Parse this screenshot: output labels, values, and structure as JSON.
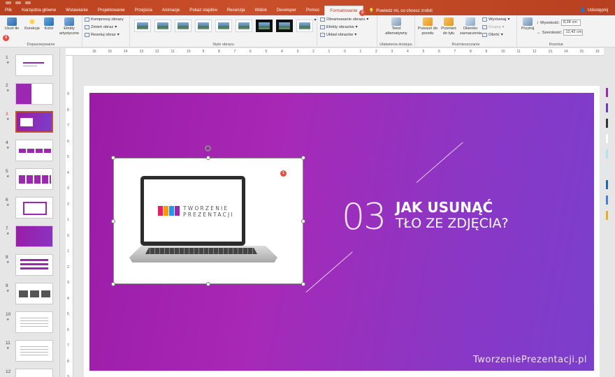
{
  "tabs": [
    "Plik",
    "Narzędzia główne",
    "Wstawianie",
    "Projektowanie",
    "Przejścia",
    "Animacje",
    "Pokaz slajdów",
    "Recenzja",
    "Widok",
    "Developer",
    "Pomoc",
    "Formatowanie"
  ],
  "tell_me": "Powiedz mi, co chcesz zrobić",
  "share": "Udostępnij",
  "ribbon": {
    "remove_bg": "Usuń tło",
    "corrections": "Korekcje",
    "color": "Kolor",
    "artistic_effects": "Efekty artystyczne",
    "compress": "Kompresuj obrazy",
    "change_picture": "Zmień obraz",
    "reset_picture": "Resetuj obraz",
    "adjust_label": "Dopasowywanie",
    "styles_label": "Style obrazu",
    "border": "Obramowanie obrazu",
    "effects": "Efekty obrazów",
    "layout": "Układ obrazów",
    "alt_text": "Tekst alternatywny",
    "accessibility_label": "Ułatwienia dostępu",
    "bring_forward": "Przesuń do przodu",
    "send_backward": "Przenieś do tyłu",
    "selection_pane": "Okienko zaznaczenia",
    "align": "Wyrównaj",
    "group": "Grupuj",
    "rotate": "Obróć",
    "arrange_label": "Rozmieszczanie",
    "crop": "Przytnij",
    "height_label": "Wysokość:",
    "height_value": "8,28 cm",
    "width_label": "Szerokość:",
    "width_value": "12,42 cm",
    "size_label": "Rozmiar"
  },
  "badges": [
    "1",
    "2",
    "3"
  ],
  "thumbs": [
    "1",
    "2",
    "3",
    "4",
    "5",
    "6",
    "7",
    "8",
    "9",
    "10",
    "11",
    "12"
  ],
  "thumb_star": "★",
  "ruler_h": [
    "16",
    "15",
    "14",
    "13",
    "12",
    "11",
    "10",
    "9",
    "8",
    "7",
    "6",
    "5",
    "4",
    "3",
    "2",
    "1",
    "0",
    "1",
    "2",
    "3",
    "4",
    "5",
    "6",
    "7",
    "8",
    "9",
    "10",
    "11",
    "12",
    "13",
    "14",
    "15",
    "16"
  ],
  "ruler_v": [
    "9",
    "8",
    "7",
    "6",
    "5",
    "4",
    "3",
    "2",
    "1",
    "0",
    "1",
    "2",
    "3",
    "4",
    "5",
    "6",
    "7",
    "8",
    "9"
  ],
  "slide": {
    "number": "03",
    "title": "JAK USUNĄĆ",
    "subtitle": "TŁO ZE ZDJĘCIA?",
    "brand": "TworzeniePrezentacji.pl",
    "laptop_logo_line1": "TWORZENIE",
    "laptop_logo_line2": "PREZENTACJI"
  },
  "colors": {
    "accent": "#c0542e",
    "slide_gradient_start": "#9a1ca6",
    "slide_gradient_end": "#7a3fcc",
    "badge": "#e44d42"
  },
  "palette": [
    "#9c27b0",
    "#6a3fb5",
    "#333333",
    "#ffffff",
    "#b3e0f2",
    "#d6ecf5",
    "#1f6aa5",
    "#4a7fc7",
    "#e8b020"
  ]
}
